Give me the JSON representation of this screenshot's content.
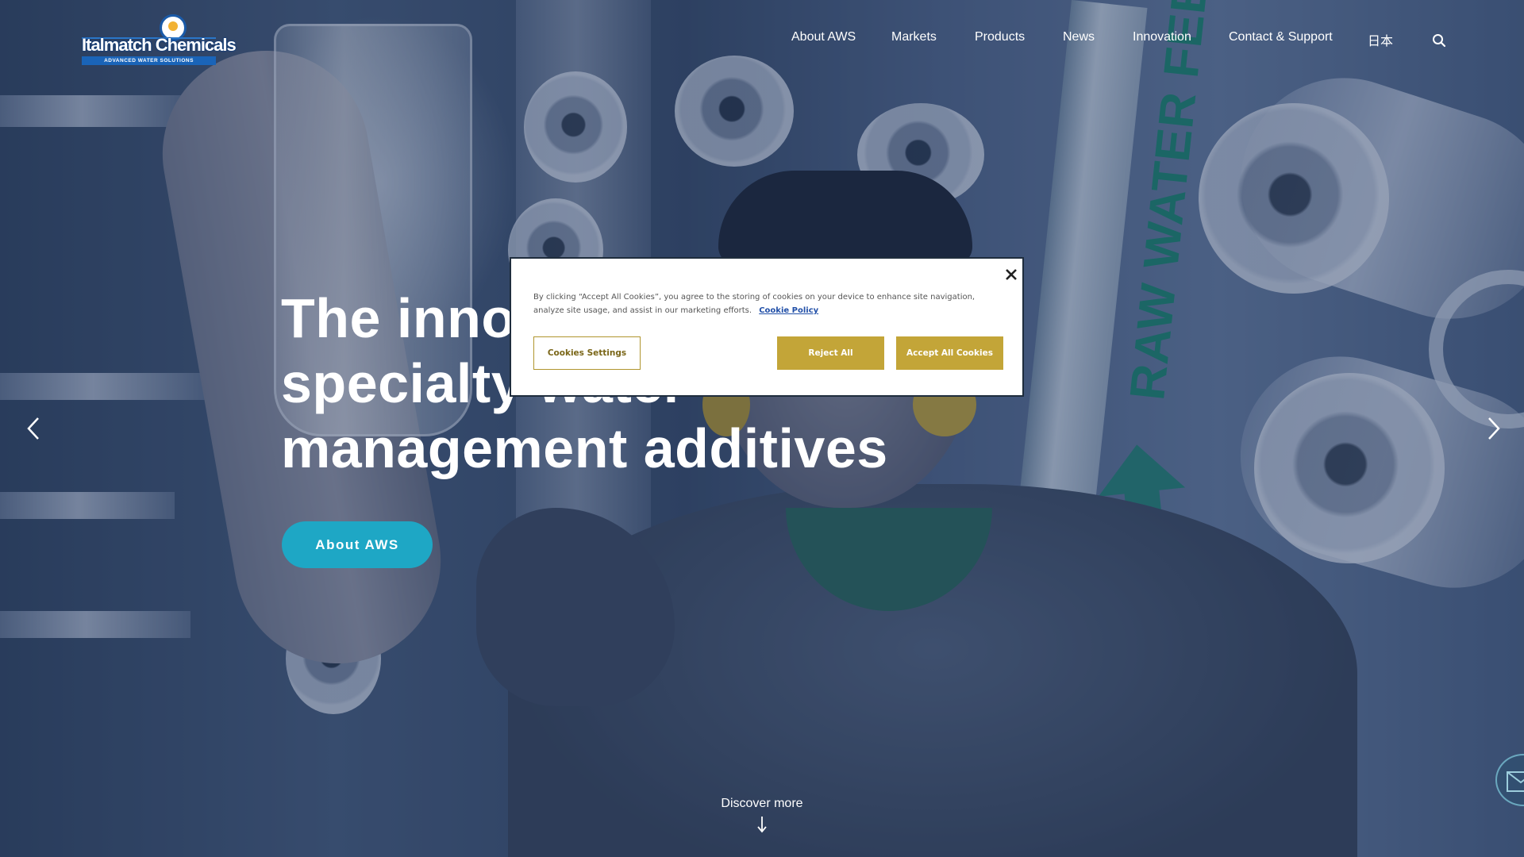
{
  "brand": {
    "name": "Italmatch Chemicals",
    "tagline": "ADVANCED WATER SOLUTIONS",
    "colors": {
      "accent": "#1ea7c5",
      "cookie_button": "#c3a538",
      "logo_blue": "#1a64b8"
    }
  },
  "nav": {
    "items": [
      "About AWS",
      "Markets",
      "Products",
      "News",
      "Innovation",
      "Contact & Support",
      "日本"
    ],
    "search_icon": "search-icon"
  },
  "hero": {
    "title_lines": [
      "The innovative",
      "specialty water",
      "management additives"
    ],
    "cta_label": "About AWS",
    "background_text": "RAW WATER FEED",
    "prev_icon": "chevron-left-icon",
    "next_icon": "chevron-right-icon",
    "discover_label": "Discover more"
  },
  "cookie_banner": {
    "text": "By clicking “Accept All Cookies”, you agree to the storing of cookies on your device to enhance site navigation, analyze site usage, and assist in our marketing efforts.",
    "policy_link": "Cookie Policy",
    "settings_label": "Cookies Settings",
    "reject_label": "Reject All",
    "accept_label": "Accept All Cookies"
  },
  "contact_fab_icon": "mail-icon"
}
